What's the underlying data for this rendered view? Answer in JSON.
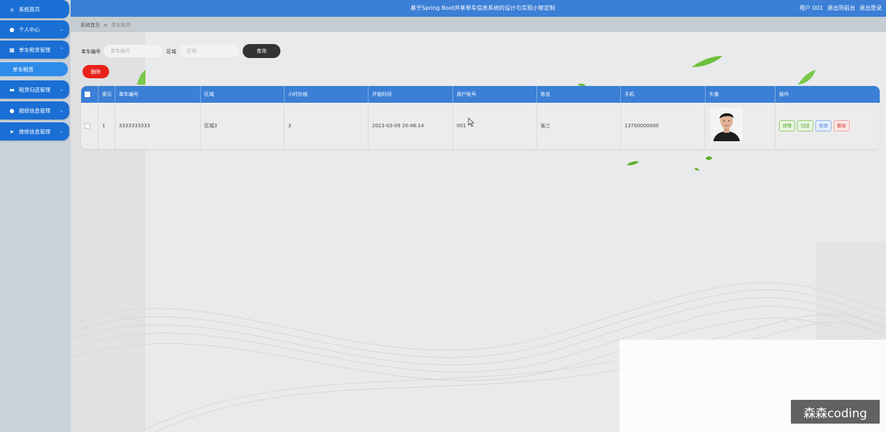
{
  "sidebar": {
    "items": [
      {
        "icon": "home-icon",
        "glyph": "⌂",
        "label": "系统首页",
        "chev": ""
      },
      {
        "icon": "user-icon",
        "glyph": "●",
        "label": "个人中心",
        "chev": "⌄"
      },
      {
        "icon": "grid-icon",
        "glyph": "▦",
        "label": "单车租赁管理",
        "chev": "⌃"
      },
      {
        "icon": "bank-icon",
        "glyph": "▬",
        "label": "租赁归还管理",
        "chev": "⌄"
      },
      {
        "icon": "person-icon",
        "glyph": "●",
        "label": "报修信息管理",
        "chev": "⌄"
      },
      {
        "icon": "send-icon",
        "glyph": "➤",
        "label": "维修信息管理",
        "chev": "⌄"
      }
    ],
    "sub_item": "单车租赁"
  },
  "header": {
    "title": "基于Spring Boot共享单车信息系统的设计与实现小智定制",
    "user": "用户 001",
    "exit_backend": "退出到前台",
    "logout": "退出登录"
  },
  "breadcrumb": {
    "home": "系统首页",
    "sep": "≡",
    "current": "单车租赁"
  },
  "search": {
    "bike_no_label": "单车编号",
    "bike_no_placeholder": "单车编号",
    "area_label": "区域",
    "area_placeholder": "区域",
    "query_button": "查询"
  },
  "actions": {
    "delete_button": "删除"
  },
  "table": {
    "headers": [
      "",
      "索引",
      "单车编号",
      "区域",
      "小时价格",
      "开始时间",
      "用户账号",
      "姓名",
      "手机",
      "头像",
      "操作"
    ],
    "rows": [
      {
        "index": "1",
        "bike_no": "3333333333",
        "area": "区域3",
        "hourly_price": "3",
        "start_time": "2023-03-09 20:48:14",
        "account": "001",
        "name": "张三",
        "phone": "13700000000",
        "ops": {
          "detail": "详情",
          "returned": "归还",
          "edit": "修改",
          "remove": "删除"
        }
      }
    ]
  },
  "watermark": "森森coding"
}
